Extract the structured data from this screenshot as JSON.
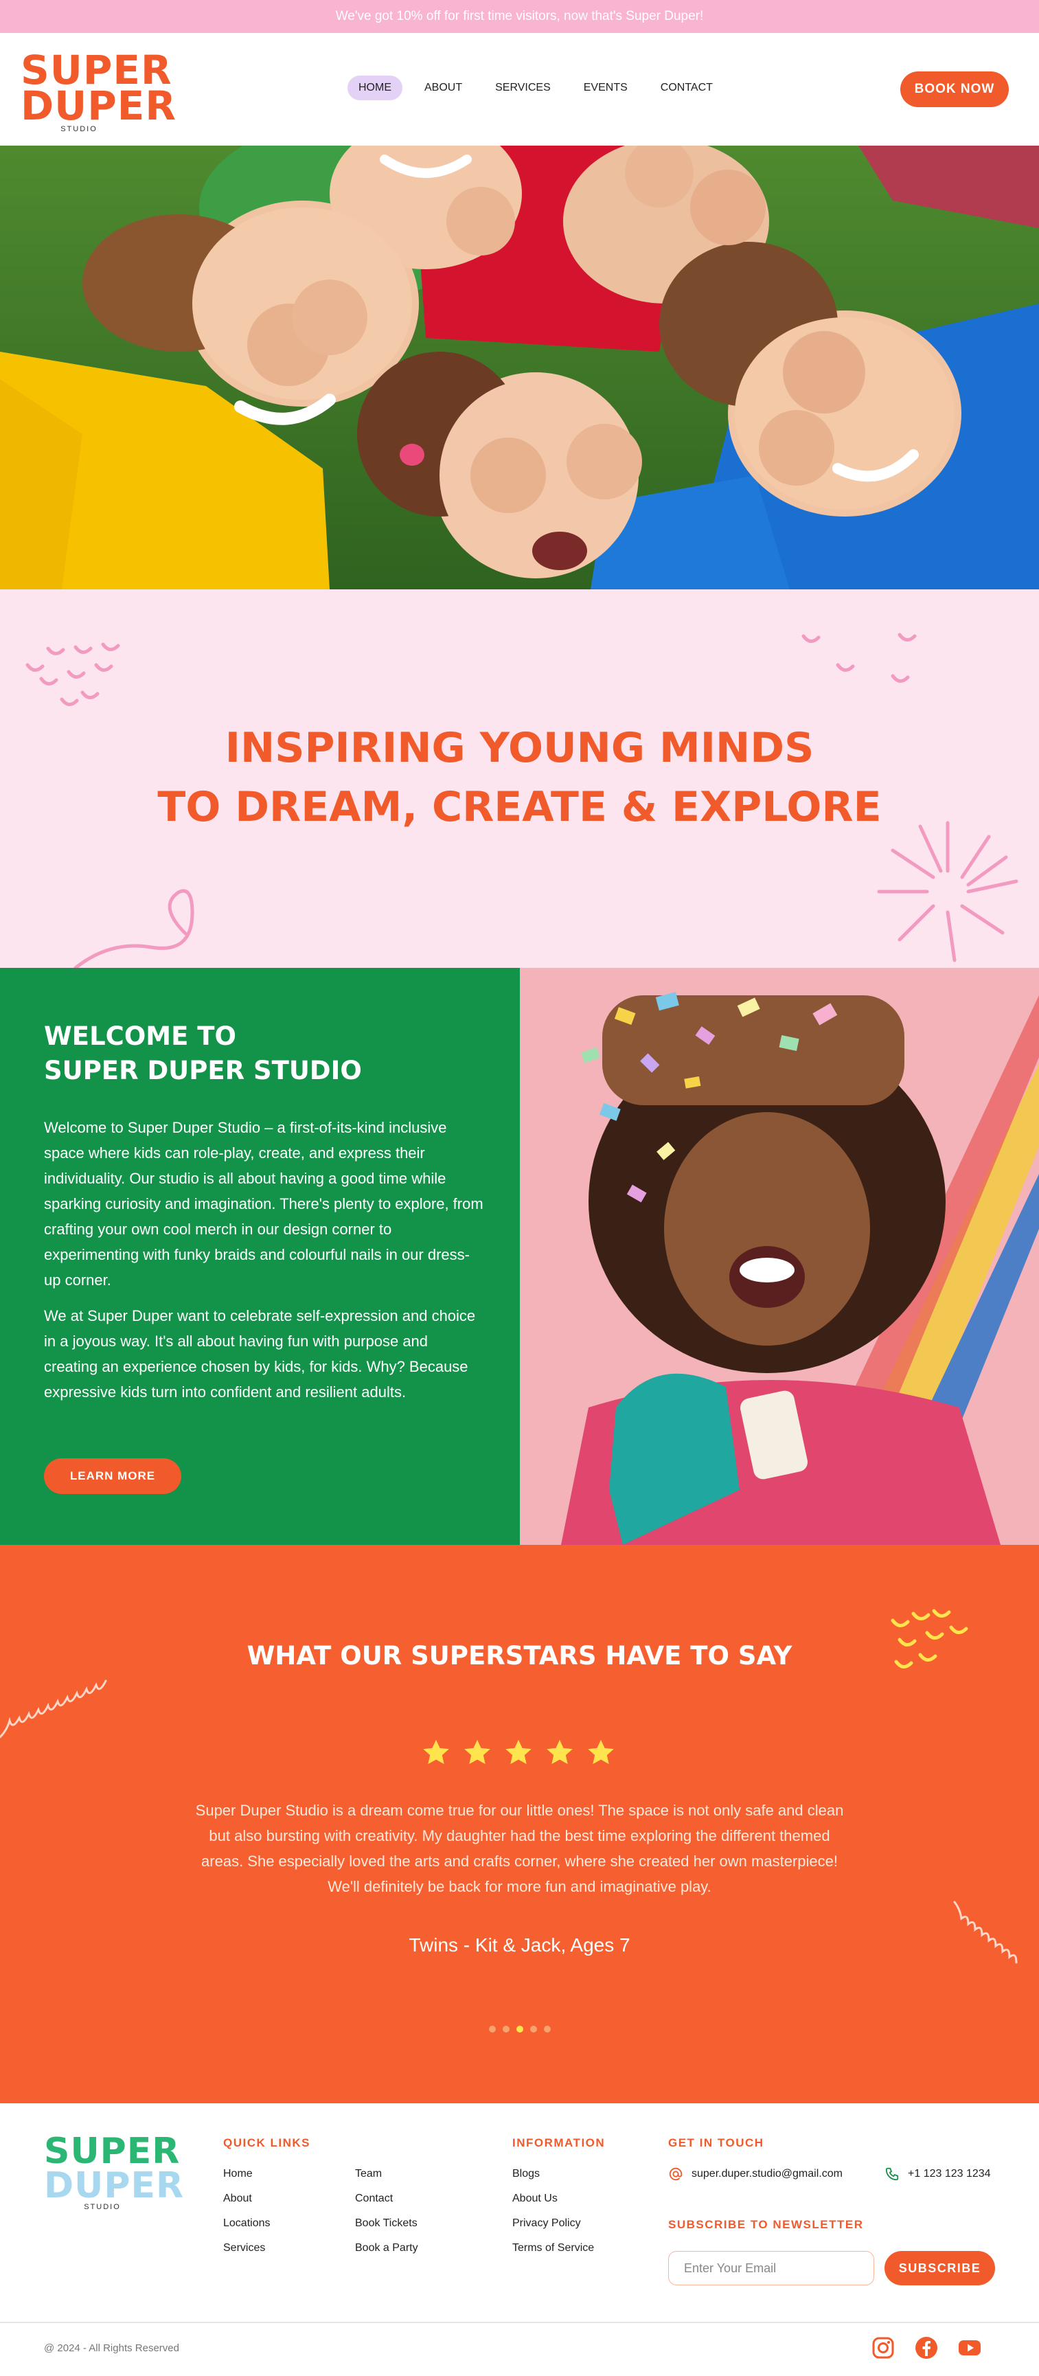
{
  "announcement": "We've got 10% off for first time visitors, now that's Super Duper!",
  "brand": {
    "line1": "SUPER",
    "line2": "DUPER",
    "line3": "STUDIO",
    "accent": "#f15a2b",
    "pink": "#fde5ef",
    "green": "#13924a",
    "orange": "#f65f2f"
  },
  "nav": {
    "items": [
      {
        "label": "HOME",
        "active": true
      },
      {
        "label": "ABOUT"
      },
      {
        "label": "SERVICES"
      },
      {
        "label": "EVENTS"
      },
      {
        "label": "CONTACT"
      }
    ],
    "book_label": "BOOK NOW"
  },
  "hero": {
    "alt": "hero-photo-kids"
  },
  "inspire": {
    "line1": "INSPIRING YOUNG MINDS",
    "line2": "TO DREAM, CREATE & EXPLORE"
  },
  "welcome": {
    "title_line1": "WELCOME TO",
    "title_line2": "SUPER DUPER STUDIO",
    "p1": "Welcome to Super Duper Studio – a first-of-its-kind inclusive space where kids can role-play, create, and express their individuality. Our studio is all about having a good time while sparking curiosity and imagination. There's plenty to explore, from crafting your own cool merch in our design corner to experimenting with funky braids and colourful nails in our dress-up corner.",
    "p2": "We at Super Duper want to celebrate self-expression and choice in a joyous way. It's all about having fun with purpose and creating an experience chosen by kids, for kids. Why? Because expressive kids turn into confident and resilient adults.",
    "button": "LEARN MORE"
  },
  "testimonials": {
    "title": "WHAT OUR SUPERSTARS HAVE TO SAY",
    "rating": 5,
    "quote": "Super Duper Studio is a dream come true for our little ones! The space is not only safe and clean but also bursting with creativity. My daughter had the best time exploring the different themed areas. She especially loved the arts and crafts corner, where she created her own masterpiece! We'll definitely be back for more fun and imaginative play.",
    "author": "Twins - Kit & Jack, Ages 7",
    "slides": 5,
    "active_slide": 3
  },
  "footer": {
    "quick_links_title": "QUICK LINKS",
    "quick_links_col1": [
      "Home",
      "About",
      "Locations",
      "Services"
    ],
    "quick_links_col2": [
      "Team",
      "Contact",
      "Book Tickets",
      "Book a Party"
    ],
    "information_title": "INFORMATION",
    "information": [
      "Blogs",
      "About Us",
      "Privacy Policy",
      "Terms of Service"
    ],
    "contact_title": "GET IN TOUCH",
    "email": "super.duper.studio@gmail.com",
    "phone": "+1 123 123 1234",
    "newsletter_title": "SUBSCRIBE TO NEWSLETTER",
    "newsletter_placeholder": "Enter Your Email",
    "subscribe": "SUBSCRIBE",
    "copyright": "@ 2024 - All Rights Reserved",
    "social": [
      "instagram-icon",
      "facebook-icon",
      "youtube-icon"
    ]
  }
}
